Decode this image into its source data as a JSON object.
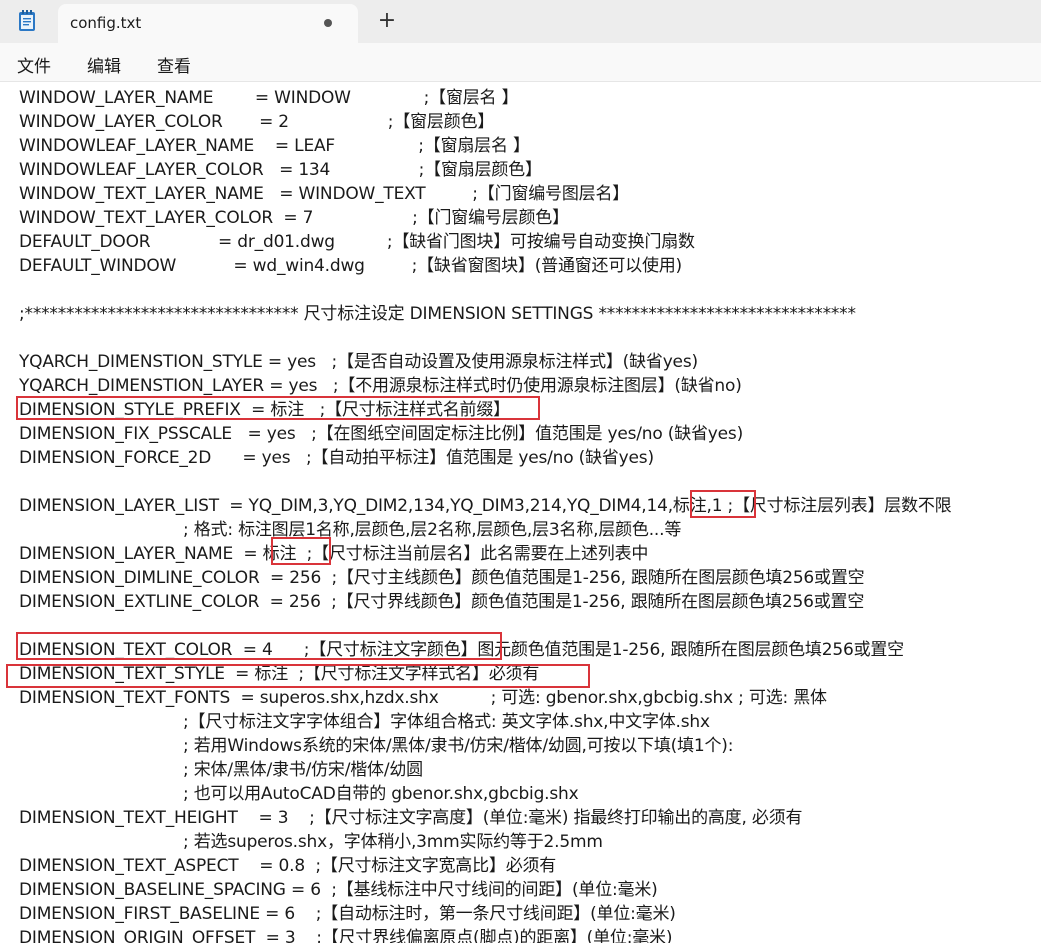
{
  "tab": {
    "title": "config.txt",
    "new_tab_label": "+"
  },
  "menu": {
    "file": "文件",
    "edit": "编辑",
    "view": "查看"
  },
  "lines": [
    "WINDOW_LAYER_NAME        = WINDOW              ;【窗层名 】",
    "WINDOW_LAYER_COLOR       = 2                   ;【窗层颜色】",
    "WINDOWLEAF_LAYER_NAME    = LEAF                ;【窗扇层名 】",
    "WINDOWLEAF_LAYER_COLOR   = 134                 ;【窗扇层颜色】",
    "WINDOW_TEXT_LAYER_NAME   = WINDOW_TEXT         ;【门窗编号图层名】",
    "WINDOW_TEXT_LAYER_COLOR  = 7                   ;【门窗编号层颜色】",
    "DEFAULT_DOOR             = dr_d01.dwg          ;【缺省门图块】可按编号自动变换门扇数",
    "DEFAULT_WINDOW           = wd_win4.dwg         ;【缺省窗图块】(普通窗还可以使用)",
    "",
    ";********************************* 尺寸标注设定 DIMENSION SETTINGS *******************************",
    "",
    "YQARCH_DIMENSTION_STYLE = yes   ;【是否自动设置及使用源泉标注样式】(缺省yes)",
    "YQARCH_DIMENSTION_LAYER = yes   ;【不用源泉标注样式时仍使用源泉标注图层】(缺省no)",
    "DIMENSION_STYLE_PREFIX  = 标注   ;【尺寸标注样式名前缀】",
    "DIMENSION_FIX_PSSCALE   = yes   ;【在图纸空间固定标注比例】值范围是 yes/no (缺省yes)",
    "DIMENSION_FORCE_2D      = yes   ;【自动拍平标注】值范围是 yes/no (缺省yes)",
    "",
    "DIMENSION_LAYER_LIST  = YQ_DIM,3,YQ_DIM2,134,YQ_DIM3,214,YQ_DIM4,14,标注,1 ;【尺寸标注层列表】层数不限",
    "; 格式: 标注图层1名称,层颜色,层2名称,层颜色,层3名称,层颜色...等",
    "DIMENSION_LAYER_NAME  = 标注  ;【尺寸标注当前层名】此名需要在上述列表中",
    "DIMENSION_DIMLINE_COLOR  = 256  ;【尺寸主线颜色】颜色值范围是1-256, 跟随所在图层颜色填256或置空",
    "DIMENSION_EXTLINE_COLOR  = 256  ;【尺寸界线颜色】颜色值范围是1-256, 跟随所在图层颜色填256或置空",
    "",
    "DIMENSION_TEXT_COLOR  = 4      ;【尺寸标注文字颜色】图元颜色值范围是1-256, 跟随所在图层颜色填256或置空",
    "DIMENSION_TEXT_STYLE  = 标注  ;【尺寸标注文字样式名】必须有",
    "DIMENSION_TEXT_FONTS  = superos.shx,hzdx.shx          ; 可选: gbenor.shx,gbcbig.shx ; 可选: 黑体",
    ";【尺寸标注文字字体组合】字体组合格式: 英文字体.shx,中文字体.shx",
    "; 若用Windows系统的宋体/黑体/隶书/仿宋/楷体/幼圆,可按以下填(填1个):",
    "; 宋体/黑体/隶书/仿宋/楷体/幼圆",
    "; 也可以用AutoCAD自带的 gbenor.shx,gbcbig.shx",
    "DIMENSION_TEXT_HEIGHT    = 3    ;【尺寸标注文字高度】(单位:毫米) 指最终打印输出的高度, 必须有",
    "; 若选superos.shx，字体稍小,3mm实际约等于2.5mm",
    "DIMENSION_TEXT_ASPECT    = 0.8  ;【尺寸标注文字宽高比】必须有",
    "DIMENSION_BASELINE_SPACING = 6  ;【基线标注中尺寸线间的间距】(单位:毫米)",
    "DIMENSION_FIRST_BASELINE = 6    ;【自动标注时，第一条尺寸线间距】(单位:毫米)",
    "DIMENSION_ORIGIN_OFFSET  = 3    ;【尺寸界线偏离原点(脚点)的距离】(单位:毫米)"
  ],
  "colors": {
    "highlight": "#d9343a",
    "titlebar": "#ededed",
    "menubar": "#f9f9f9"
  },
  "icons": {
    "app": "notepad-icon",
    "unsaved": "unsaved-dot-icon",
    "new_tab": "plus-icon"
  }
}
